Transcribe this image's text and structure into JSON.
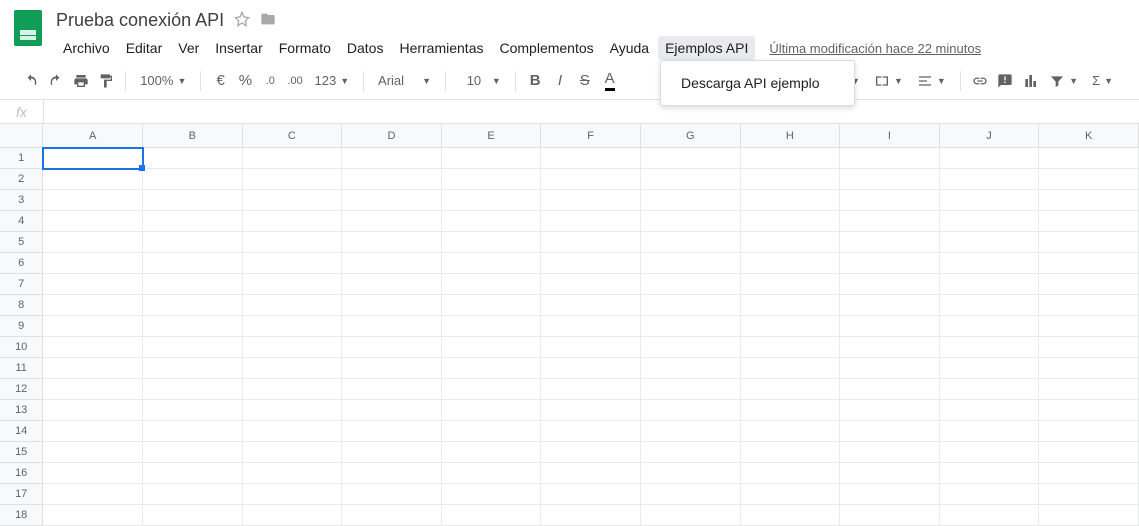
{
  "header": {
    "title": "Prueba conexión API",
    "last_modified": "Última modificación hace 22 minutos"
  },
  "menus": [
    "Archivo",
    "Editar",
    "Ver",
    "Insertar",
    "Formato",
    "Datos",
    "Herramientas",
    "Complementos",
    "Ayuda",
    "Ejemplos API"
  ],
  "active_menu_index": 9,
  "dropdown": {
    "items": [
      "Descarga API ejemplo"
    ]
  },
  "toolbar": {
    "zoom": "100%",
    "currency": "€",
    "percent": "%",
    "dec_dec": ".0",
    "dec_inc": ".00",
    "more_formats": "123",
    "font": "Arial",
    "size": "10"
  },
  "formula_bar": {
    "label": "fx",
    "value": ""
  },
  "grid": {
    "columns": [
      "A",
      "B",
      "C",
      "D",
      "E",
      "F",
      "G",
      "H",
      "I",
      "J",
      "K"
    ],
    "rows": [
      1,
      2,
      3,
      4,
      5,
      6,
      7,
      8,
      9,
      10,
      11,
      12,
      13,
      14,
      15,
      16,
      17,
      18
    ],
    "selected": "A1"
  }
}
